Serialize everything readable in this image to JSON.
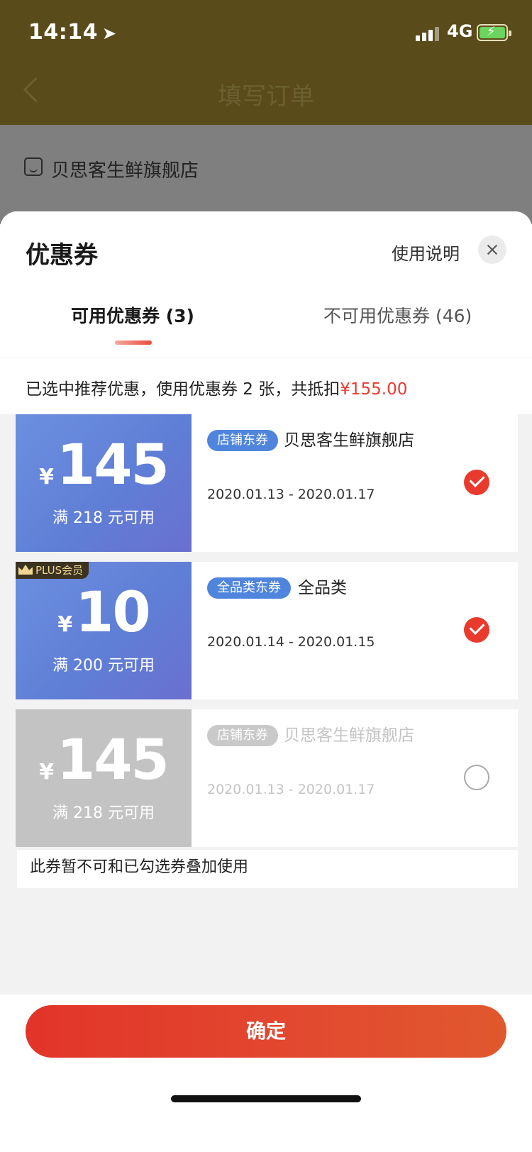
{
  "status_bar": {
    "time": "14:14",
    "network": "4G"
  },
  "background_page": {
    "title": "填写订单",
    "store_name": "贝思客生鲜旗舰店"
  },
  "sheet": {
    "title": "优惠券",
    "help_link": "使用说明",
    "tabs": [
      {
        "label": "可用优惠券 (3)",
        "active": true
      },
      {
        "label": "不可用优惠券 (46)",
        "active": false
      }
    ],
    "summary": {
      "text": "已选中推荐优惠，使用优惠券 2 张，共抵扣",
      "amount": "¥155.00"
    }
  },
  "coupons": [
    {
      "currency": "¥",
      "amount": "145",
      "condition": "满 218 元可用",
      "tag": "店铺东券",
      "scope": "贝思客生鲜旗舰店",
      "dates": "2020.01.13 - 2020.01.17",
      "selected": true,
      "enabled": true
    },
    {
      "badge": "PLUS会员",
      "currency": "¥",
      "amount": "10",
      "condition": "满 200 元可用",
      "tag": "全品类东券",
      "scope": "全品类",
      "dates": "2020.01.14 - 2020.01.15",
      "selected": true,
      "enabled": true
    },
    {
      "currency": "¥",
      "amount": "145",
      "condition": "满 218 元可用",
      "tag": "店铺东券",
      "scope": "贝思客生鲜旗舰店",
      "dates": "2020.01.13 - 2020.01.17",
      "selected": false,
      "enabled": false,
      "note": "此券暂不可和已勾选券叠加使用"
    }
  ],
  "confirm_label": "确定",
  "colors": {
    "accent_red": "#e83b2e",
    "coupon_blue": "#5f7fd6",
    "disabled_gray": "#c3c3c3"
  }
}
